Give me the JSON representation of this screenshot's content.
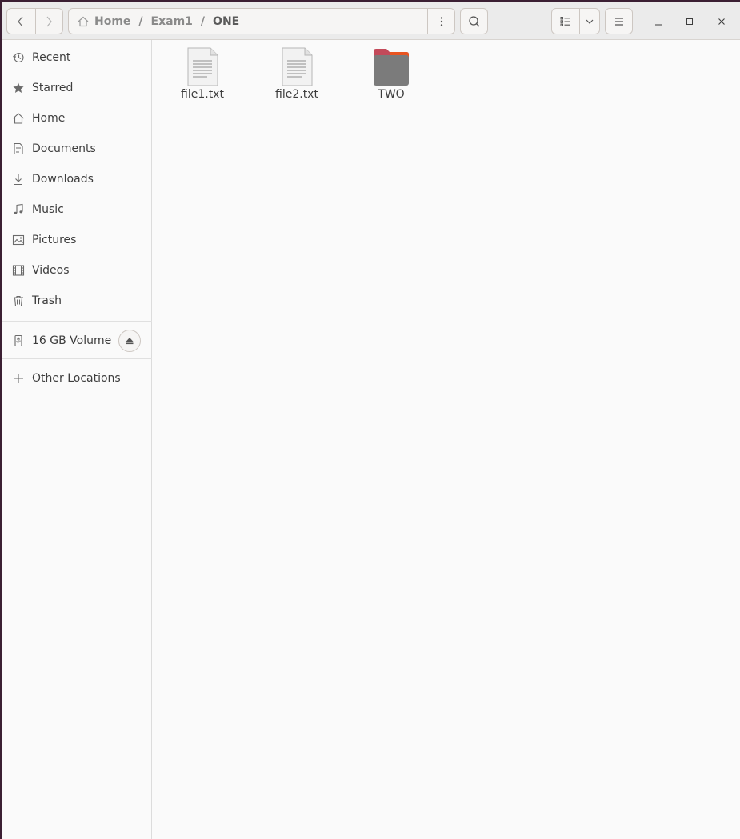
{
  "navigation": {
    "back_icon": "chevron-left-icon",
    "forward_icon": "chevron-right-icon"
  },
  "pathbar": {
    "crumbs": [
      {
        "label": "Home",
        "icon": "home-icon"
      },
      {
        "label": "Exam1"
      },
      {
        "label": "ONE"
      }
    ],
    "separator": "/"
  },
  "sidebar": {
    "places": [
      {
        "label": "Recent",
        "icon": "clock-icon"
      },
      {
        "label": "Starred",
        "icon": "star-icon"
      },
      {
        "label": "Home",
        "icon": "home-icon"
      },
      {
        "label": "Documents",
        "icon": "document-icon"
      },
      {
        "label": "Downloads",
        "icon": "download-icon"
      },
      {
        "label": "Music",
        "icon": "music-icon"
      },
      {
        "label": "Pictures",
        "icon": "picture-icon"
      },
      {
        "label": "Videos",
        "icon": "film-icon"
      },
      {
        "label": "Trash",
        "icon": "trash-icon"
      }
    ],
    "devices": [
      {
        "label": "16 GB Volume",
        "icon": "usb-drive-icon"
      }
    ],
    "other": {
      "label": "Other Locations",
      "icon": "plus-icon"
    }
  },
  "files": [
    {
      "name": "file1.txt",
      "type": "text-file"
    },
    {
      "name": "file2.txt",
      "type": "text-file"
    },
    {
      "name": "TWO",
      "type": "folder"
    }
  ],
  "colors": {
    "folder_body": "#7b7b7b",
    "folder_tab": "#c34a5a",
    "accent": "#e95420"
  }
}
